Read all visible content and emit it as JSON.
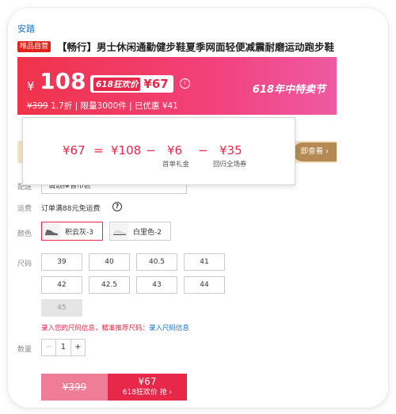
{
  "brand": "安踏",
  "store_tag": "唯品自营",
  "title": "【畅行】男士休闲通勤健步鞋夏季网面轻便减震耐磨运动跑步鞋",
  "price_banner": {
    "yen": "¥",
    "price": "108",
    "badge_tag": "618狂欢价",
    "badge_price": "¥67",
    "info_icon": "i",
    "festival": "618年中特卖节",
    "original_price": "¥399",
    "discount": "1.7折",
    "limit": "限量3000件",
    "saved": "已优惠 ¥41"
  },
  "coupon_strip": {
    "button": "即查看 ›"
  },
  "popup": {
    "result": "¥67",
    "eq": "=",
    "base": "¥108",
    "minus1": "−",
    "d1": "¥6",
    "d1_label": "首单礼金",
    "minus2": "−",
    "d2": "¥35",
    "d2_label": "回归全场券"
  },
  "delivery": {
    "label": "配送",
    "placeholder": "请选择省市区"
  },
  "shipping": {
    "label": "运费",
    "text": "订单满88元免运费",
    "help": "?"
  },
  "color": {
    "label": "颜色",
    "options": [
      {
        "name": "积云灰-3",
        "selected": true
      },
      {
        "name": "白里色-2",
        "selected": false
      }
    ]
  },
  "size": {
    "label": "尺码",
    "options": [
      "39",
      "40",
      "40.5",
      "41",
      "42",
      "42.5",
      "43",
      "44",
      "45"
    ],
    "disabled": [
      "45"
    ],
    "hint": "录入您的尺码信息，精准推荐尺码：",
    "link": "录入尺码信息"
  },
  "quantity": {
    "label": "数量",
    "minus": "−",
    "value": "1",
    "plus": "+"
  },
  "buy": {
    "original": "¥399",
    "price": "¥67",
    "label": "618狂欢价 抢 ›"
  },
  "colors": {
    "accent": "#e8284a",
    "link": "#1a73c8",
    "gold": "#b48a52"
  },
  "icons": [
    "info-icon",
    "help-icon",
    "chevron-down-icon"
  ]
}
